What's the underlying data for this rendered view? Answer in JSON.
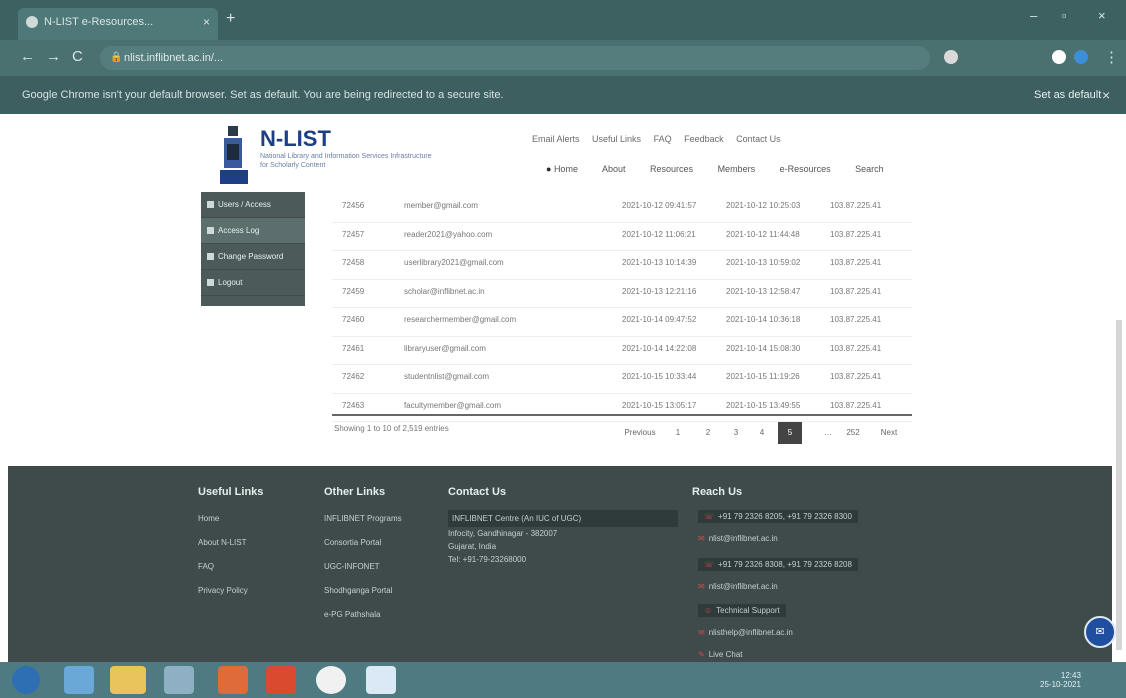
{
  "browser": {
    "tab_title": "N-LIST e-Resources...",
    "tab_close": "×",
    "new_tab": "+",
    "url": "nlist.inflibnet.ac.in/...",
    "window_controls": [
      "–",
      "▫",
      "×"
    ],
    "nav": [
      "←",
      "→",
      "C"
    ],
    "infobar_message": "Google Chrome isn't your default browser. Set as default. You are being redirected to a secure site.",
    "infobar_action": "Set as default",
    "infobar_close": "×"
  },
  "site": {
    "logo_title": "N-LIST",
    "logo_subtitle": "National Library and Information Services Infrastructure for Scholarly Content",
    "top_links": [
      "Email Alerts",
      "Useful Links",
      "FAQ",
      "Feedback",
      "Contact Us"
    ],
    "nav": [
      "Home",
      "About",
      "Resources",
      "Members",
      "e-Resources",
      "Search"
    ]
  },
  "sidebar": {
    "items": [
      {
        "label": "Users / Access",
        "active": false
      },
      {
        "label": "Access Log",
        "active": true
      },
      {
        "label": "Change Password",
        "active": false
      },
      {
        "label": "Logout",
        "active": false
      }
    ]
  },
  "table": {
    "rows": [
      {
        "id": "72456",
        "email": "member@gmail.com",
        "login": "2021-10-12 09:41:57",
        "logout": "2021-10-12 10:25:03",
        "ip": "103.87.225.41"
      },
      {
        "id": "72457",
        "email": "reader2021@yahoo.com",
        "login": "2021-10-12 11:06:21",
        "logout": "2021-10-12 11:44:48",
        "ip": "103.87.225.41"
      },
      {
        "id": "72458",
        "email": "userlibrary2021@gmail.com",
        "login": "2021-10-13 10:14:39",
        "logout": "2021-10-13 10:59:02",
        "ip": "103.87.225.41"
      },
      {
        "id": "72459",
        "email": "scholar@inflibnet.ac.in",
        "login": "2021-10-13 12:21:16",
        "logout": "2021-10-13 12:58:47",
        "ip": "103.87.225.41"
      },
      {
        "id": "72460",
        "email": "researchermember@gmail.com",
        "login": "2021-10-14 09:47:52",
        "logout": "2021-10-14 10:36:18",
        "ip": "103.87.225.41"
      },
      {
        "id": "72461",
        "email": "libraryuser@gmail.com",
        "login": "2021-10-14 14:22:08",
        "logout": "2021-10-14 15:08:30",
        "ip": "103.87.225.41"
      },
      {
        "id": "72462",
        "email": "studentnlist@gmail.com",
        "login": "2021-10-15 10:33:44",
        "logout": "2021-10-15 11:19:26",
        "ip": "103.87.225.41"
      },
      {
        "id": "72463",
        "email": "facultymember@gmail.com",
        "login": "2021-10-15 13:05:17",
        "logout": "2021-10-15 13:49:55",
        "ip": "103.87.225.41"
      }
    ],
    "showing": "Showing 1 to 10 of 2,519 entries"
  },
  "pager": {
    "previous": "Previous",
    "pages": [
      "1",
      "2",
      "3",
      "4",
      "5"
    ],
    "current": "5",
    "ellipsis": "…",
    "last": "252",
    "next": "Next"
  },
  "footer": {
    "useful_links": {
      "heading": "Useful Links",
      "items": [
        "Home",
        "About N-LIST",
        "FAQ",
        "Privacy Policy"
      ]
    },
    "other_links": {
      "heading": "Other Links",
      "items": [
        "INFLIBNET Programs",
        "Consortia Portal",
        "UGC-INFONET",
        "Shodhganga Portal",
        "e-PG Pathshala"
      ]
    },
    "contact": {
      "heading": "Contact Us",
      "lines": [
        "INFLIBNET Centre (An IUC of UGC)",
        "Infocity, Gandhinagar - 382007",
        "Gujarat, India",
        "Tel: +91-79-23268000"
      ]
    },
    "reach_us": {
      "heading": "Reach Us",
      "items": [
        {
          "label": "+91 79 2326 8205, +91 79 2326 8300",
          "icon": "phone-icon"
        },
        {
          "label": "nlist@inflibnet.ac.in",
          "icon": "mail-icon"
        },
        {
          "label": "+91 79 2326 8308, +91 79 2326 8208",
          "icon": "phone-icon"
        },
        {
          "label": "nlist@inflibnet.ac.in",
          "icon": "mail-icon"
        },
        {
          "label": "Technical Support",
          "icon": "user-icon"
        },
        {
          "label": "nlisthelp@inflibnet.ac.in",
          "icon": "mail-icon"
        },
        {
          "label": "Live Chat",
          "icon": "chat-icon"
        }
      ]
    },
    "chat_button": "✉"
  },
  "taskbar": {
    "clock_time": "12:43",
    "clock_date": "25-10-2021"
  },
  "colors": {
    "chrome": "#3d6161",
    "footer": "#3f4b4b",
    "sidebar": "#4c5a5a",
    "taskbar": "#4e7a82",
    "accent": "#1d3f83"
  }
}
